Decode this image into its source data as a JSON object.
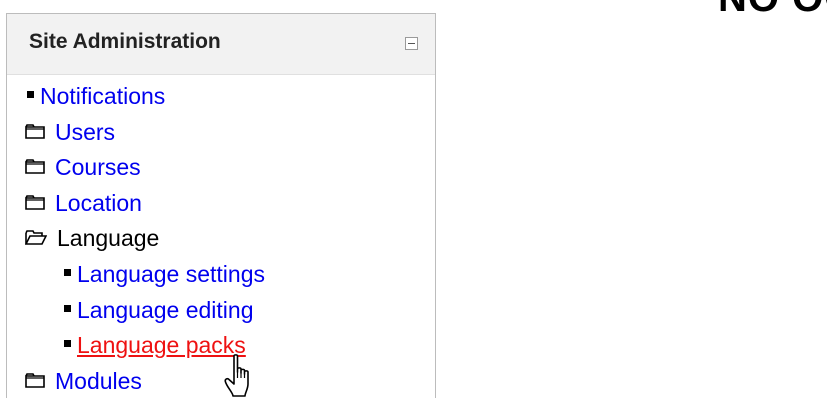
{
  "top_heading_fragment": "NO OO",
  "site_admin_block": {
    "title": "Site Administration",
    "hide_toggle": "collapse-icon",
    "items": [
      {
        "kind": "link-bullet",
        "label": "Notifications",
        "icon": "bullet-icon"
      },
      {
        "kind": "folder-closed",
        "label": "Users",
        "icon": "folder-closed-icon"
      },
      {
        "kind": "folder-closed",
        "label": "Courses",
        "icon": "folder-closed-icon"
      },
      {
        "kind": "folder-closed",
        "label": "Location",
        "icon": "folder-closed-icon"
      },
      {
        "kind": "folder-open",
        "label": "Language",
        "icon": "folder-open-icon"
      },
      {
        "kind": "link-bullet",
        "label": "Language settings",
        "icon": "bullet-icon"
      },
      {
        "kind": "link-bullet",
        "label": "Language editing",
        "icon": "bullet-icon"
      },
      {
        "kind": "link-bullet-hover",
        "label": "Language packs",
        "icon": "bullet-icon"
      },
      {
        "kind": "folder-closed",
        "label": "Modules",
        "icon": "folder-closed-icon"
      }
    ]
  },
  "colors": {
    "link": "#0000ee",
    "link_hover": "#ee1111",
    "header_bg": "#f2f2f2",
    "border": "#bcbcbc"
  },
  "cursor": "hand-pointer-icon"
}
